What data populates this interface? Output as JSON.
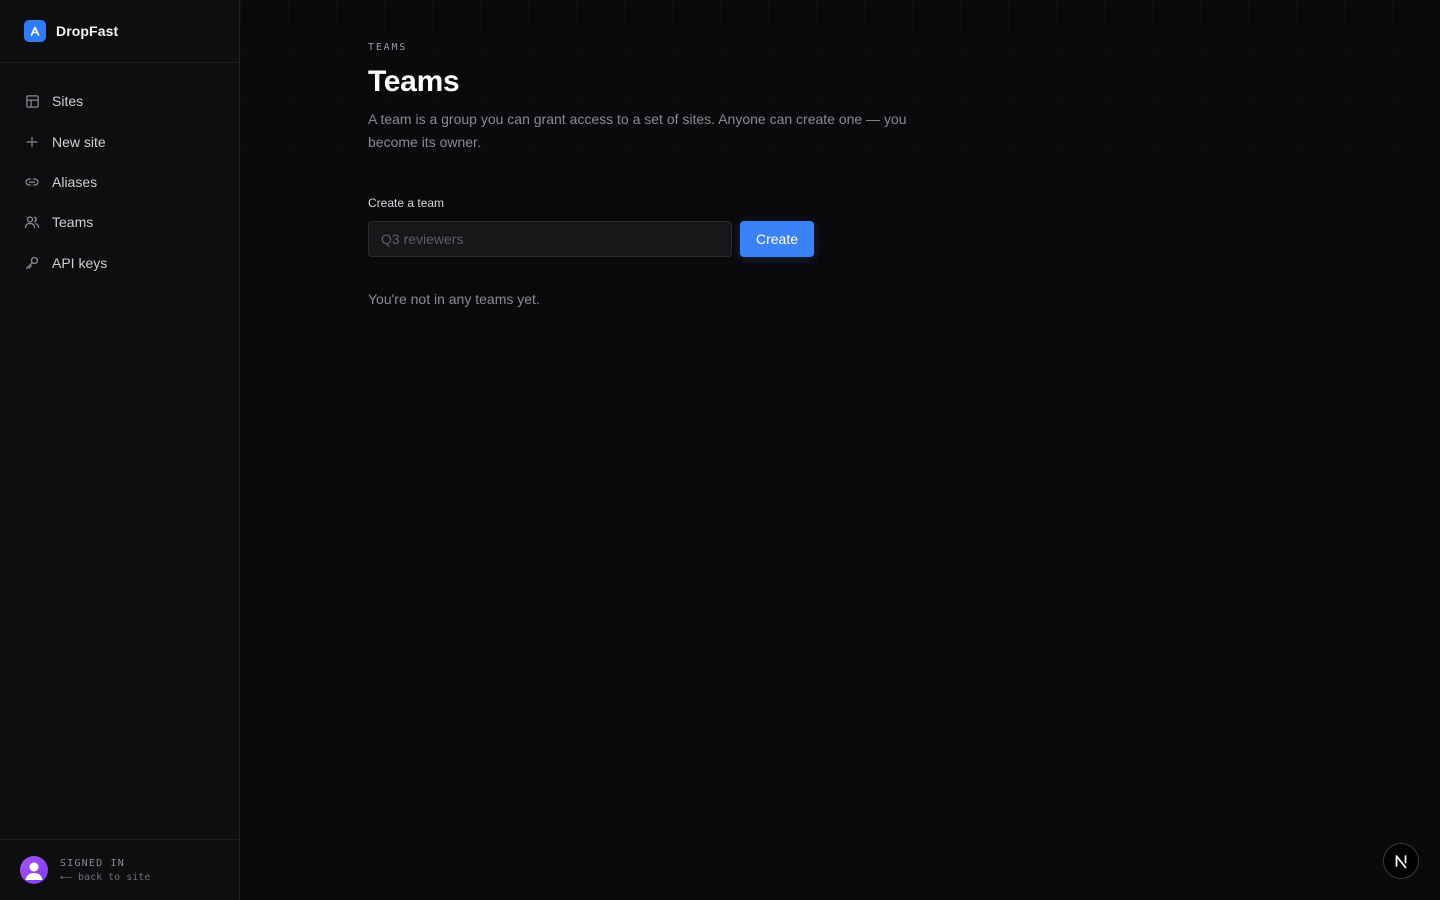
{
  "app": {
    "name": "DropFast",
    "accent_color": "#3b82f6",
    "logo_icon": "arrow-up-logo-icon"
  },
  "sidebar": {
    "items": [
      {
        "label": "Sites",
        "icon": "grid-icon"
      },
      {
        "label": "New site",
        "icon": "plus-icon"
      },
      {
        "label": "Aliases",
        "icon": "link-icon"
      },
      {
        "label": "Teams",
        "icon": "users-icon"
      },
      {
        "label": "API keys",
        "icon": "key-icon"
      }
    ],
    "footer": {
      "status": "SIGNED IN",
      "back_link": "←— back to site",
      "avatar_icon": "user-avatar-icon"
    }
  },
  "main": {
    "eyebrow": "TEAMS",
    "title": "Teams",
    "description": "A team is a group you can grant access to a set of sites. Anyone can create one — you become its owner.",
    "form": {
      "label": "Create a team",
      "input_value": "",
      "input_placeholder": "Q3 reviewers",
      "submit_label": "Create"
    },
    "empty_state": "You're not in any teams yet."
  },
  "floating_badge": {
    "icon": "nextjs-n-icon"
  }
}
